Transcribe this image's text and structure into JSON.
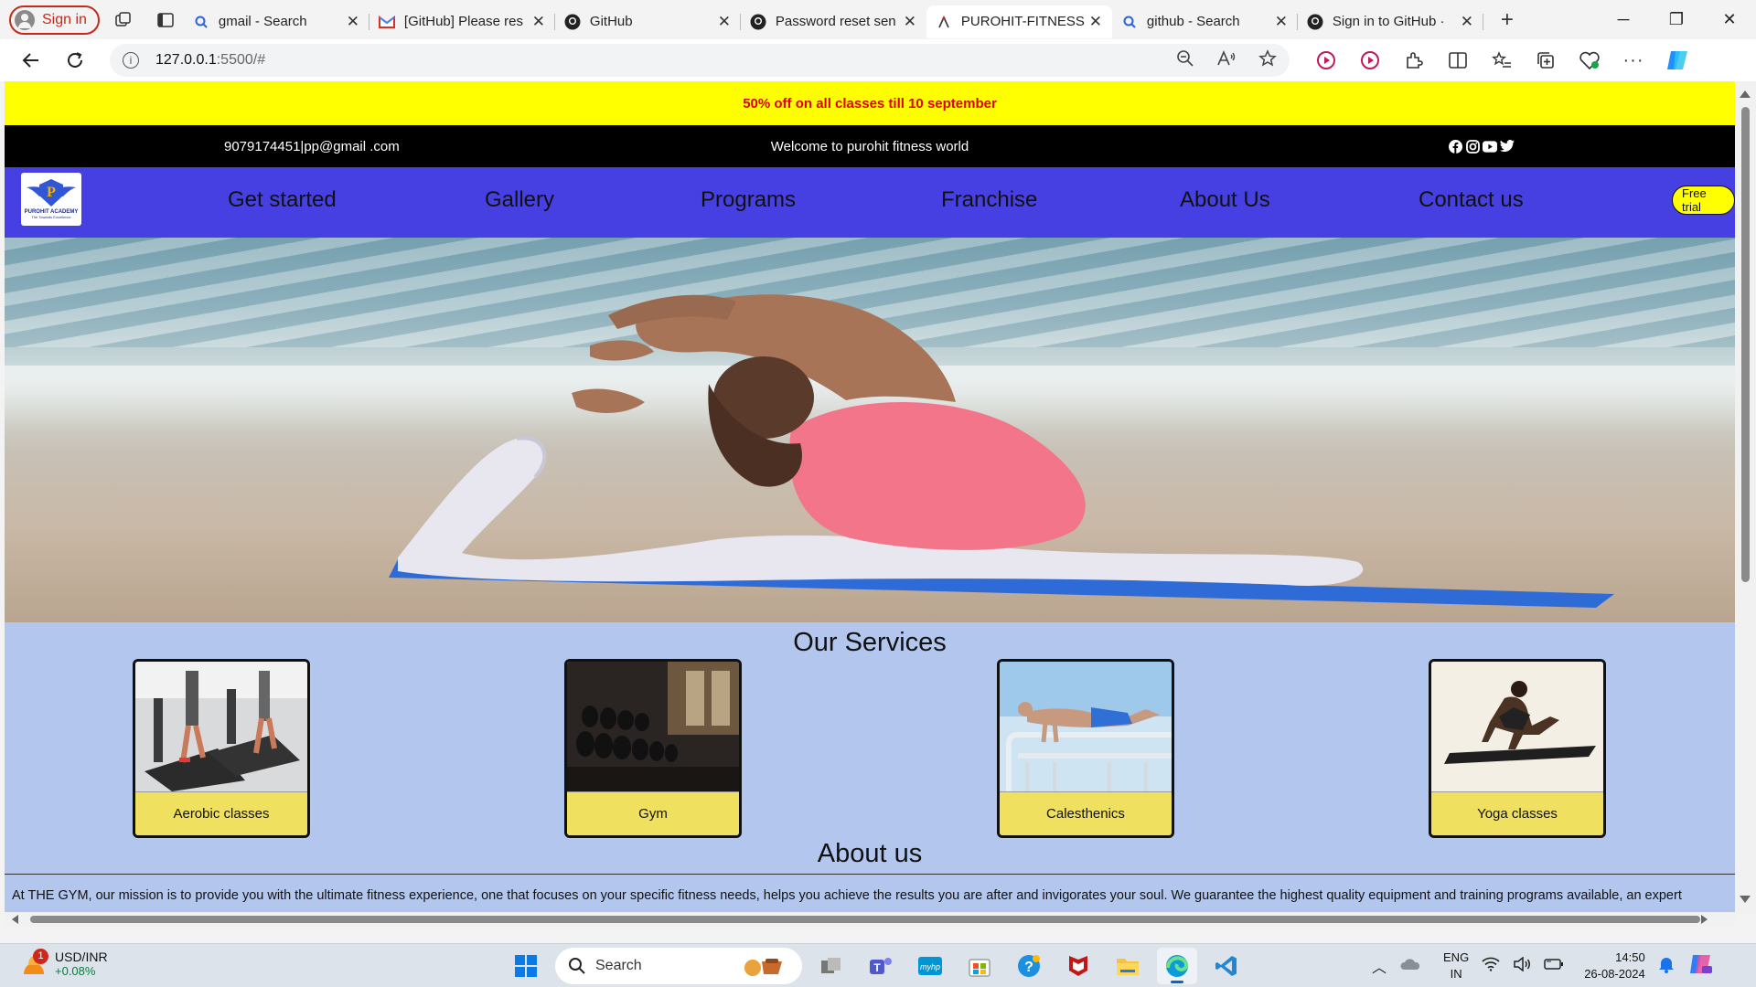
{
  "browser": {
    "signin_label": "Sign in",
    "tabs": [
      {
        "title": "gmail - Search",
        "icon": "search-icon"
      },
      {
        "title": "[GitHub] Please res",
        "icon": "gmail-icon"
      },
      {
        "title": "GitHub",
        "icon": "github-icon"
      },
      {
        "title": "Password reset sen",
        "icon": "github-icon"
      },
      {
        "title": "PUROHIT-FITNESS",
        "icon": "page-icon",
        "active": true
      },
      {
        "title": "github - Search",
        "icon": "search-icon"
      },
      {
        "title": "Sign in to GitHub ·",
        "icon": "github-icon"
      }
    ],
    "url_host": "127.0.0.1",
    "url_path": ":5500/#"
  },
  "page": {
    "offer": "50% off on all classes till 10 september",
    "contact": "9079174451|pp@gmail .com",
    "welcome": "Welcome to purohit fitness world",
    "logo": {
      "title": "PUROHIT ACADEMY",
      "subtitle": "The Towards Excellence",
      "letter": "P"
    },
    "nav": [
      "Get started",
      "Gallery",
      "Programs",
      "Franchise",
      "About Us",
      "Contact us"
    ],
    "free_trial": "Free trial",
    "services_title": "Our Services",
    "services": [
      "Aerobic classes",
      "Gym",
      "Calesthenics",
      "Yoga classes"
    ],
    "about_title": "About us",
    "about_text": "At THE GYM, our mission is to provide you with the ultimate fitness experience, one that focuses on your specific fitness needs, helps you achieve the results you are after and invigorates your soul. We guarantee the highest quality equipment and training programs available, an expert"
  },
  "taskbar": {
    "ticker": "USD/INR",
    "ticker_change": "+0.08%",
    "notification_count": "1",
    "search_placeholder": "Search",
    "lang_1": "ENG",
    "lang_2": "IN",
    "time": "14:50",
    "date": "26-08-2024"
  },
  "colors": {
    "offer_bg": "#ffff00",
    "offer_text": "#e00000",
    "nav_bg": "#4640e3",
    "services_bg": "#b3c7ee",
    "card_caption": "#f0e060"
  }
}
